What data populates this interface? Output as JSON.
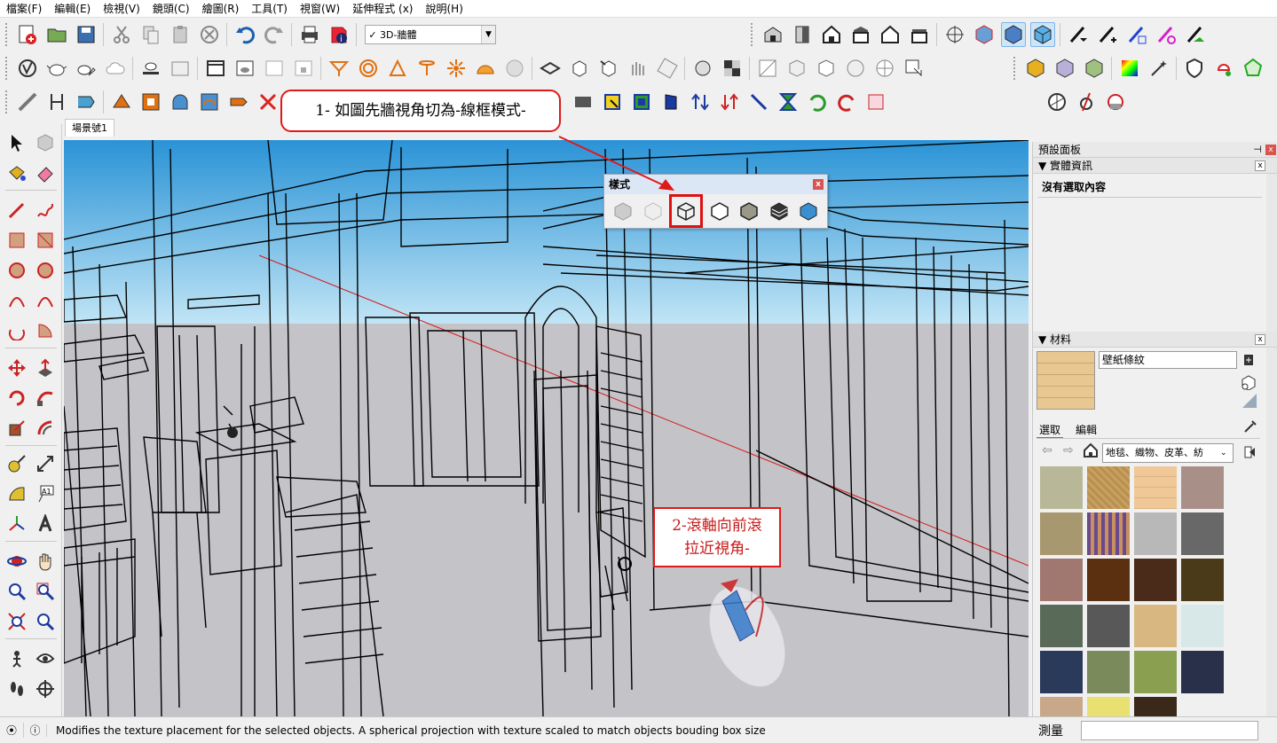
{
  "menu": [
    "檔案(F)",
    "編輯(E)",
    "檢視(V)",
    "鏡頭(C)",
    "繪圖(R)",
    "工具(T)",
    "視窗(W)",
    "延伸程式 (x)",
    "說明(H)"
  ],
  "scene_select": {
    "value": "3D-牆體",
    "check": "✓"
  },
  "scene_tab": "場景號1",
  "style_popup": {
    "title": "樣式",
    "close": "x"
  },
  "callout1": "1- 如圖先牆視角切為-線框模式-",
  "callout2": {
    "line1": "2-滾軸向前滾",
    "line2": "拉近視角-"
  },
  "right_panel": {
    "tray_title": "預設面板",
    "entity_info": {
      "title": "實體資訊",
      "content": "沒有選取內容"
    },
    "materials": {
      "title": "材料",
      "current_name": "壁紙條紋",
      "tab_select": "選取",
      "tab_edit": "編輯",
      "collection": "地毯、織物、皮革、紡"
    }
  },
  "status": {
    "text": "Modifies the texture placement for the selected objects. A spherical projection with texture scaled to match objects bouding box size",
    "measure_label": "測量"
  },
  "colors": {
    "accent_red": "#e01818",
    "sky_top": "#2a93d6",
    "ground": "#c3c3c8"
  }
}
